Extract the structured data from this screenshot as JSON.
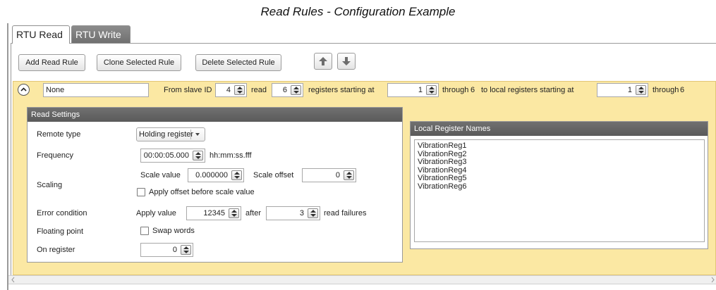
{
  "caption": "Read Rules - Configuration Example",
  "tabs": [
    {
      "label": "RTU Read",
      "active": true
    },
    {
      "label": "RTU Write",
      "active": false
    }
  ],
  "toolbar": {
    "add_label": "Add Read Rule",
    "clone_label": "Clone Selected Rule",
    "delete_label": "Delete Selected Rule",
    "up_icon": "arrow-up-icon",
    "down_icon": "arrow-down-icon"
  },
  "rule": {
    "name": "None",
    "from_slave_label": "From slave ID",
    "slave_id": "4",
    "read_label": "read",
    "count": "6",
    "registers_label": "registers starting at",
    "start": "1",
    "through_label": "through",
    "through_value": "6",
    "local_label": "to local registers starting at",
    "local_start": "1",
    "local_through_label": "through",
    "local_through_value": "6"
  },
  "read_settings": {
    "title": "Read Settings",
    "remote_type_label": "Remote type",
    "remote_type_value": "Holding register",
    "frequency_label": "Frequency",
    "frequency_value": "00:00:05.000",
    "frequency_format": "hh:mm:ss.fff",
    "scaling_label": "Scaling",
    "scale_value_label": "Scale value",
    "scale_value": "0.000000",
    "scale_offset_label": "Scale offset",
    "scale_offset": "0",
    "apply_offset_label": "Apply offset before scale value",
    "apply_offset_checked": false,
    "error_label": "Error condition",
    "apply_value_label": "Apply value",
    "apply_value": "12345",
    "after_label": "after",
    "failures": "3",
    "read_failures_label": "read failures",
    "floating_label": "Floating point",
    "swap_words_label": "Swap words",
    "swap_words_checked": false,
    "on_register_label": "On register",
    "on_register_value": "0"
  },
  "local_names": {
    "title": "Local Register Names",
    "items": [
      "VibrationReg1",
      "VibrationReg2",
      "VibrationReg3",
      "VibrationReg4",
      "VibrationReg5",
      "VibrationReg6"
    ]
  },
  "colors": {
    "rule_background": "#fbe8a3",
    "section_header": "#666666",
    "tab_inactive": "#7c7c7c"
  }
}
